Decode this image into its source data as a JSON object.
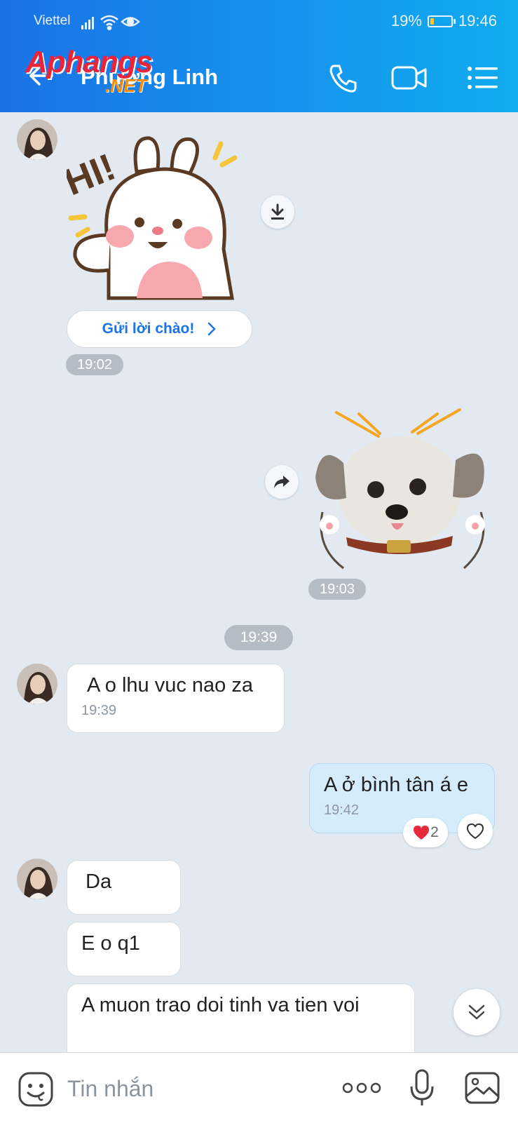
{
  "status_bar": {
    "carrier": "Viettel",
    "battery_text": "19%",
    "battery_level": 0.19,
    "time": "19:46",
    "icons": [
      "signal-icon",
      "wifi-icon",
      "eye-icon",
      "battery-icon"
    ]
  },
  "header": {
    "contact_name": "Phương Linh",
    "watermark": "Aphangs",
    "watermark_suffix": ".NET",
    "actions": [
      "back-arrow-icon",
      "phone-icon",
      "video-call-icon",
      "menu-icon"
    ]
  },
  "messages": {
    "hi_sticker_caption": "HI!",
    "greeting_button": "Gửi lời chào!",
    "time_1": "19:02",
    "time_2": "19:03",
    "divider_time": "19:39",
    "msg_1_text": "A o lhu vuc nao za",
    "msg_1_time": "19:39",
    "msg_2_text": "A ở bình tân á e",
    "msg_2_time": "19:42",
    "msg_2_reaction_count": "2",
    "msg_3_text": "Da",
    "msg_4_text": "E o q1",
    "msg_5_text": "A muon trao doi tinh va tien voi"
  },
  "input_bar": {
    "placeholder": "Tin nhắn",
    "icons": [
      "emoji-icon",
      "more-icon",
      "microphone-icon",
      "image-icon"
    ]
  },
  "colors": {
    "header_start": "#1a72e6",
    "header_end": "#10abef",
    "background": "#e2e9f1",
    "my_bubble": "#d5ecfc",
    "link": "#1a73e8"
  }
}
